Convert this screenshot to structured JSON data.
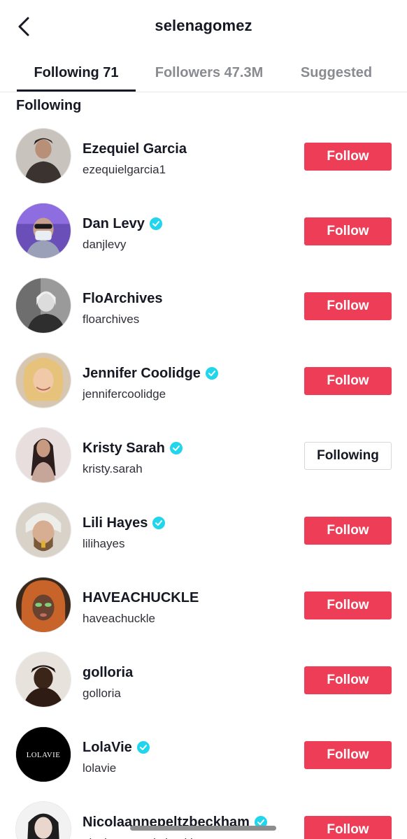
{
  "header": {
    "title": "selenagomez",
    "back_icon": "chevron-left-icon"
  },
  "tabs": [
    {
      "label": "Following 71",
      "active": true
    },
    {
      "label": "Followers 47.3M",
      "active": false
    },
    {
      "label": "Suggested",
      "active": false
    }
  ],
  "section_title": "Following",
  "colors": {
    "accent": "#ee3d56",
    "verified": "#20d5ec",
    "text": "#161823",
    "muted": "#8a8b91"
  },
  "users": [
    {
      "name": "Ezequiel Garcia",
      "handle": "ezequielgarcia1",
      "verified": false,
      "button": "Follow"
    },
    {
      "name": "Dan Levy",
      "handle": "danjlevy",
      "verified": true,
      "button": "Follow"
    },
    {
      "name": "FloArchives",
      "handle": "floarchives",
      "verified": false,
      "button": "Follow"
    },
    {
      "name": "Jennifer Coolidge",
      "handle": "jennifercoolidge",
      "verified": true,
      "button": "Follow"
    },
    {
      "name": "Kristy Sarah",
      "handle": "kristy.sarah",
      "verified": true,
      "button": "Following"
    },
    {
      "name": "Lili Hayes",
      "handle": "lilihayes",
      "verified": true,
      "button": "Follow"
    },
    {
      "name": "HAVEACHUCKLE",
      "handle": "haveachuckle",
      "verified": false,
      "button": "Follow"
    },
    {
      "name": "golloria",
      "handle": "golloria",
      "verified": false,
      "button": "Follow"
    },
    {
      "name": "LolaVie",
      "handle": "lolavie",
      "verified": true,
      "button": "Follow",
      "avatar_text": "LOLAVIE"
    },
    {
      "name": "Nicolaannepeltzbeckham",
      "handle": "nicolaannepeltzbeckham",
      "verified": true,
      "button": "Follow"
    }
  ]
}
